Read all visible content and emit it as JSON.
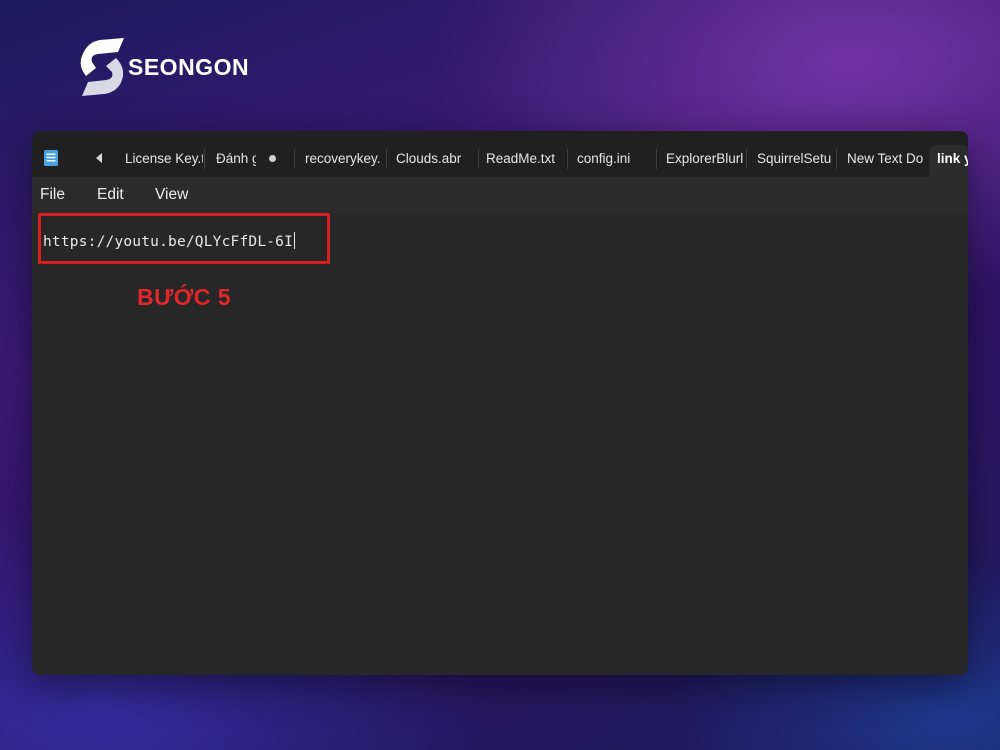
{
  "brand": {
    "name": "SEONGON"
  },
  "tabs": [
    {
      "label": "License Key.t"
    },
    {
      "label": "Đánh g"
    },
    {
      "label": "recoverykey."
    },
    {
      "label": "Clouds.abr"
    },
    {
      "label": "ReadMe.txt"
    },
    {
      "label": "config.ini"
    },
    {
      "label": "ExplorerBlurl"
    },
    {
      "label": "SquirrelSetu"
    },
    {
      "label": "New Text Do"
    },
    {
      "label": "link y"
    }
  ],
  "menu": {
    "file": "File",
    "edit": "Edit",
    "view": "View"
  },
  "editor": {
    "content": "https://youtu.be/QLYcFfDL-6I"
  },
  "annotation": {
    "step": "BƯỚC 5"
  },
  "colors": {
    "highlight": "#d32020",
    "accent_text": "#e0262a",
    "window_bg": "#272727",
    "tabbar_bg": "#202020"
  }
}
